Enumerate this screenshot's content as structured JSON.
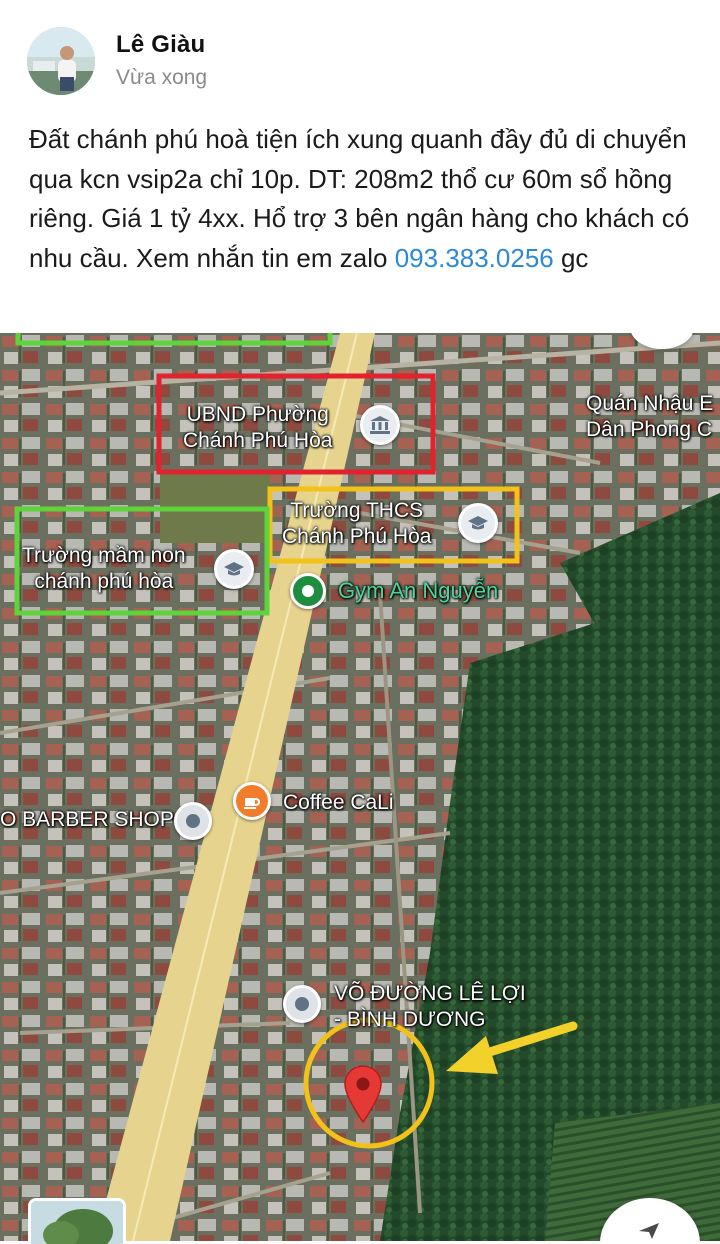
{
  "post": {
    "author_name": "Lê Giàu",
    "time": "Vừa xong",
    "body_text": "Đất chánh phú hoà tiện ích xung quanh đầy đủ di chuyển qua kcn vsip2a chỉ 10p. DT: 208m2 thổ cư 60m sổ hồng riêng. Giá 1 tỷ 4xx. Hổ trợ 3 bên ngân hàng cho khách có nhu cầu. Xem nhắn tin em zalo",
    "phone": "093.383.0256",
    "suffix": "gc"
  },
  "map": {
    "labels": {
      "ubnd_line1": "UBND Phường",
      "ubnd_line2": "Chánh Phú Hòa",
      "thcs_line1": "Trường THCS",
      "thcs_line2": "Chánh Phú Hòa",
      "mamnon_line1": "Trường mầm non",
      "mamnon_line2": "chánh phú hòa",
      "gym": "Gym An Nguyễn",
      "quan_nhau_line1": "Quán Nhậu E",
      "quan_nhau_line2": "Dân Phong C",
      "coffee": "Coffee CaLi",
      "barber": "O BARBER SHOP",
      "vo_duong_line1": "VÕ ĐƯỜNG LÊ LỢI",
      "vo_duong_line2": "- BÌNH DƯƠNG"
    },
    "colors": {
      "ubnd_box": "#e0232e",
      "thcs_box": "#f2c21b",
      "mamnon_box": "#5fd33a",
      "target_circle": "#f2c21b",
      "arrow": "#f2d12a",
      "target_pin": "#e53935"
    },
    "icons": {
      "government": "institution-icon",
      "school": "school-cap-icon",
      "coffee": "coffee-cup-icon",
      "place": "place-dot-icon",
      "target": "red-map-pin-icon"
    }
  }
}
